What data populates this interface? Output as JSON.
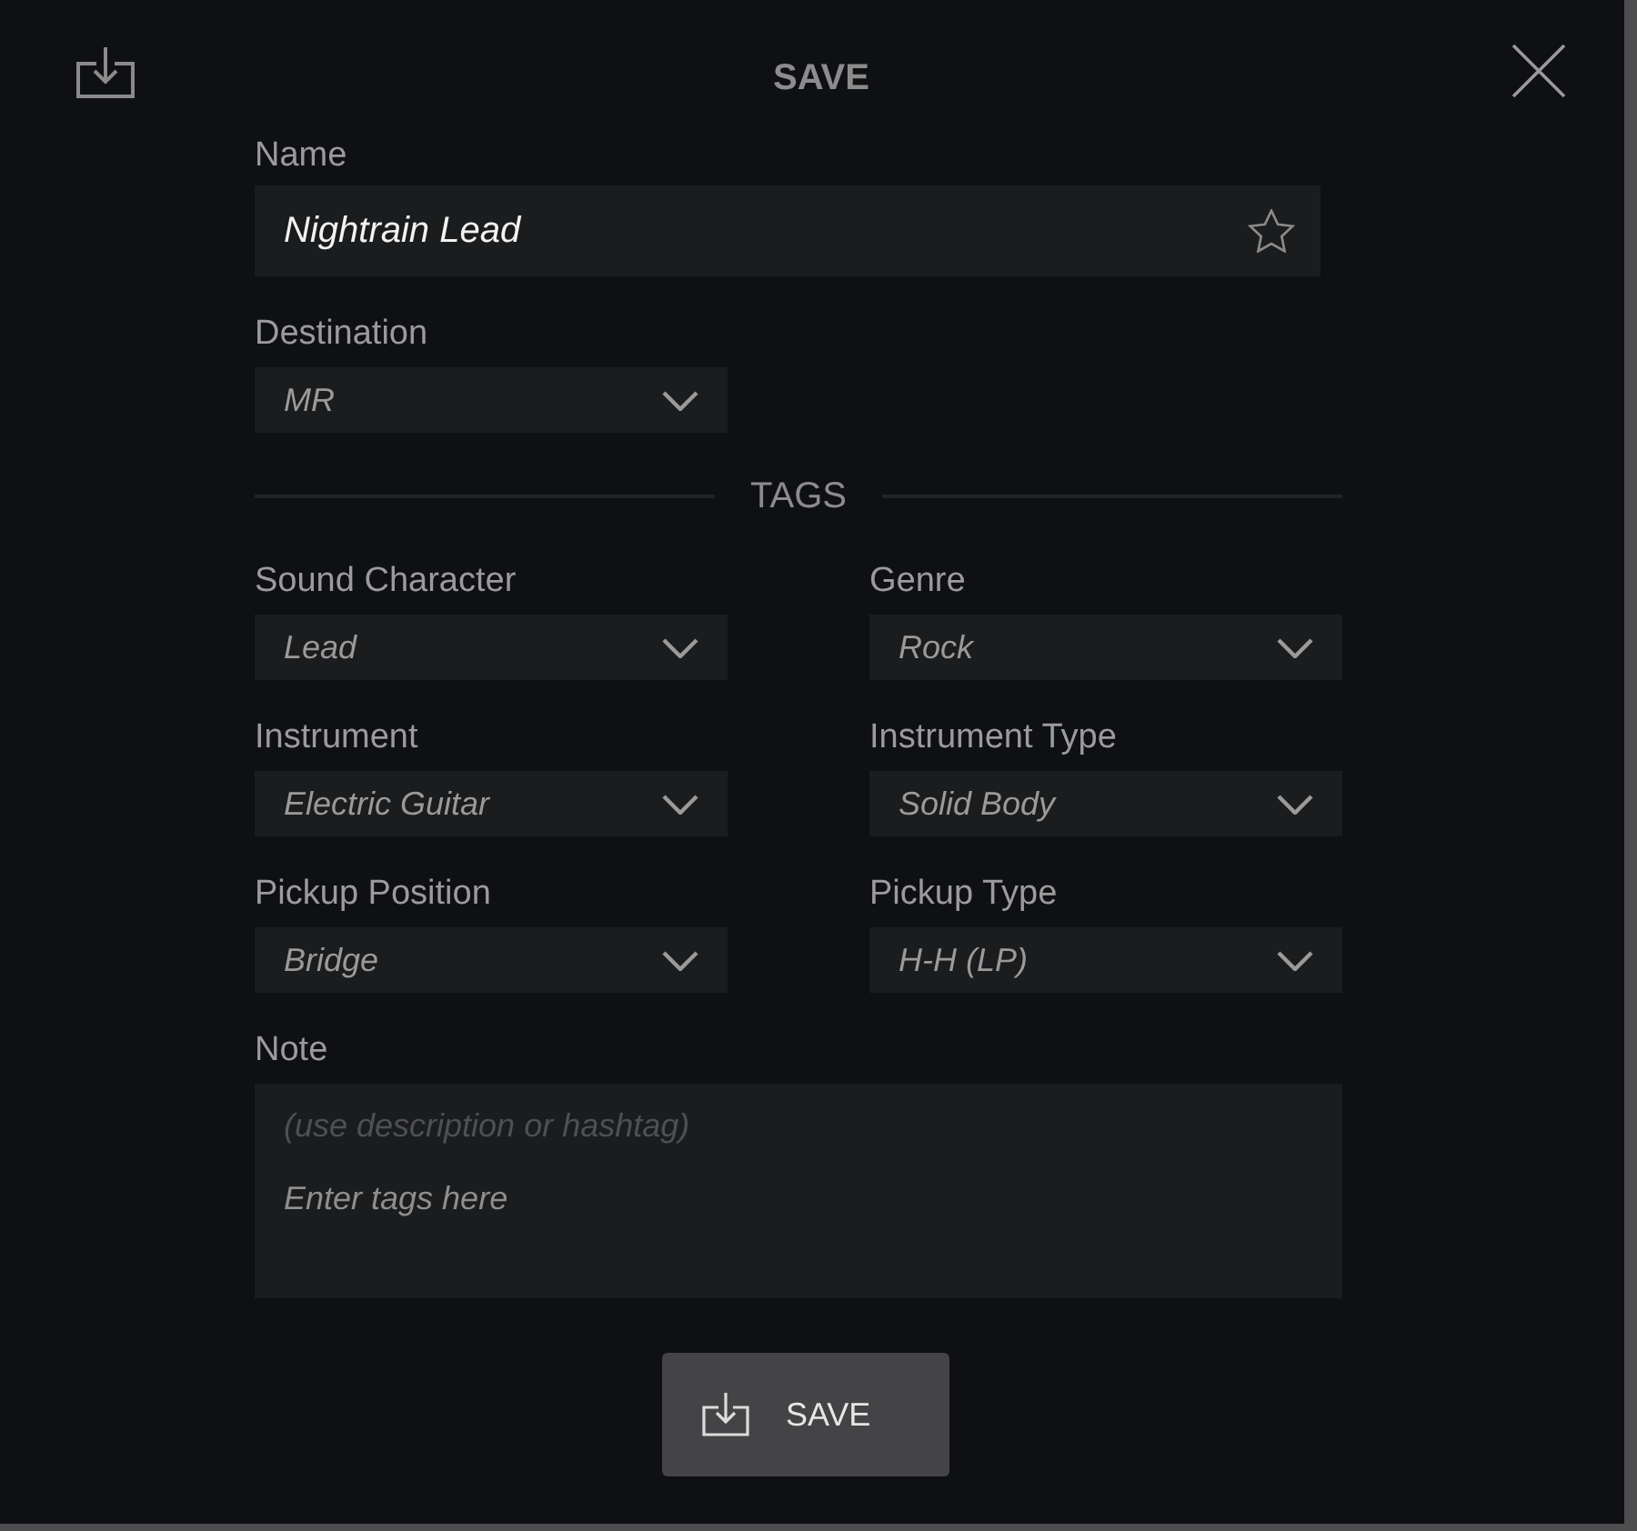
{
  "dialog": {
    "title": "SAVE"
  },
  "name": {
    "label": "Name",
    "value": "Nightrain Lead",
    "starred": false
  },
  "destination": {
    "label": "Destination",
    "value": "MR"
  },
  "tags": {
    "heading": "TAGS",
    "fields": [
      {
        "label": "Sound Character",
        "value": "Lead"
      },
      {
        "label": "Genre",
        "value": "Rock"
      },
      {
        "label": "Instrument",
        "value": "Electric Guitar"
      },
      {
        "label": "Instrument Type",
        "value": "Solid Body"
      },
      {
        "label": "Pickup Position",
        "value": "Bridge"
      },
      {
        "label": "Pickup Type",
        "value": "H-H (LP)"
      }
    ]
  },
  "note": {
    "label": "Note",
    "hint": "(use description or hashtag)",
    "placeholder": "Enter tags here"
  },
  "save_button": {
    "label": "SAVE"
  }
}
